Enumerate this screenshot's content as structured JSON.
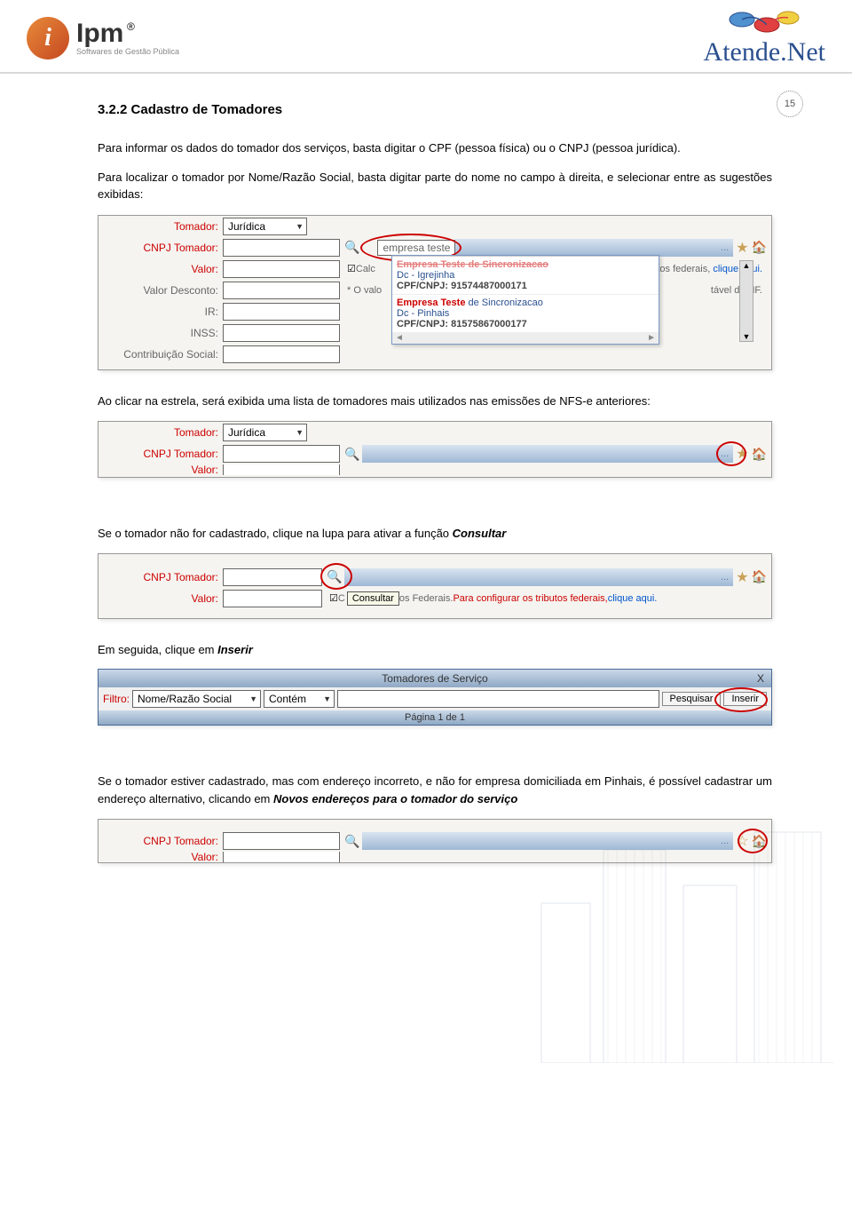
{
  "page_number": "15",
  "header": {
    "logo_ipm_main": "Ipm",
    "logo_ipm_sub": "Softwares de Gestão Pública",
    "logo_ipm_reg": "®",
    "logo_atende": "Atende.Net"
  },
  "section": {
    "title": "3.2.2 Cadastro de Tomadores",
    "para1": "Para informar os dados do tomador dos serviços, basta digitar o CPF (pessoa física) ou o CNPJ (pessoa jurídica).",
    "para2": "Para localizar o tomador por Nome/Razão Social, basta digitar parte do nome no campo à direita, e selecionar entre as sugestões exibidas:",
    "para3": "Ao clicar na estrela, será exibida uma lista de tomadores mais utilizados nas emissões de NFS-e anteriores:",
    "para4_pre": "Se o tomador não for cadastrado, clique na lupa para ativar a função ",
    "para4_bold": "Consultar",
    "para5_pre": "Em seguida, clique em ",
    "para5_bold": "Inserir",
    "para6_pre": "Se o tomador estiver cadastrado, mas com endereço incorreto, e não for empresa domiciliada em Pinhais, é possível cadastrar um endereço alternativo, clicando em ",
    "para6_bold": "Novos endereços para o tomador do serviço"
  },
  "screenshot1": {
    "labels": {
      "tomador": "Tomador:",
      "cnpj": "CNPJ Tomador:",
      "valor": "Valor:",
      "desconto": "Valor Desconto:",
      "ir": "IR:",
      "inss": "INSS:",
      "contrib": "Contribuição Social:"
    },
    "tomador_value": "Jurídica",
    "search_text": "empresa teste",
    "calc_label": "Calc",
    "ovalo_label": "* O valo",
    "dots": "...",
    "side_text1": "ibutos federais, ",
    "side_link": "clique aqui.",
    "side_text2": "tável da NF.",
    "suggestions": [
      {
        "name": "Empresa Teste de Sincronizacao",
        "loc": "Dc - Igrejinha",
        "doc": "CPF/CNPJ: 91574487000171"
      },
      {
        "name": "Empresa Teste de Sincronizacao",
        "loc": "Dc - Pinhais",
        "doc": "CPF/CNPJ: 81575867000177"
      }
    ]
  },
  "screenshot2": {
    "labels": {
      "tomador": "Tomador:",
      "cnpj": "CNPJ Tomador:",
      "valor": "Valor:"
    },
    "tomador_value": "Jurídica",
    "dots": "..."
  },
  "screenshot3": {
    "labels": {
      "cnpj": "CNPJ Tomador:",
      "valor": "Valor:"
    },
    "dots": "...",
    "tooltip": "Consultar",
    "fed_pre": "os Federais. ",
    "fed_red": "Para configurar os tributos federais, ",
    "fed_link": "clique aqui."
  },
  "screenshot4": {
    "title": "Tomadores de Serviço",
    "close": "X",
    "filtro_label": "Filtro:",
    "filter_field": "Nome/Razão Social",
    "filter_op": "Contém",
    "btn_pesquisar": "Pesquisar",
    "btn_inserir": "Inserir",
    "footer": "Página 1 de 1"
  },
  "screenshot5": {
    "labels": {
      "cnpj": "CNPJ Tomador:",
      "valor": "Valor:"
    },
    "dots": "..."
  }
}
